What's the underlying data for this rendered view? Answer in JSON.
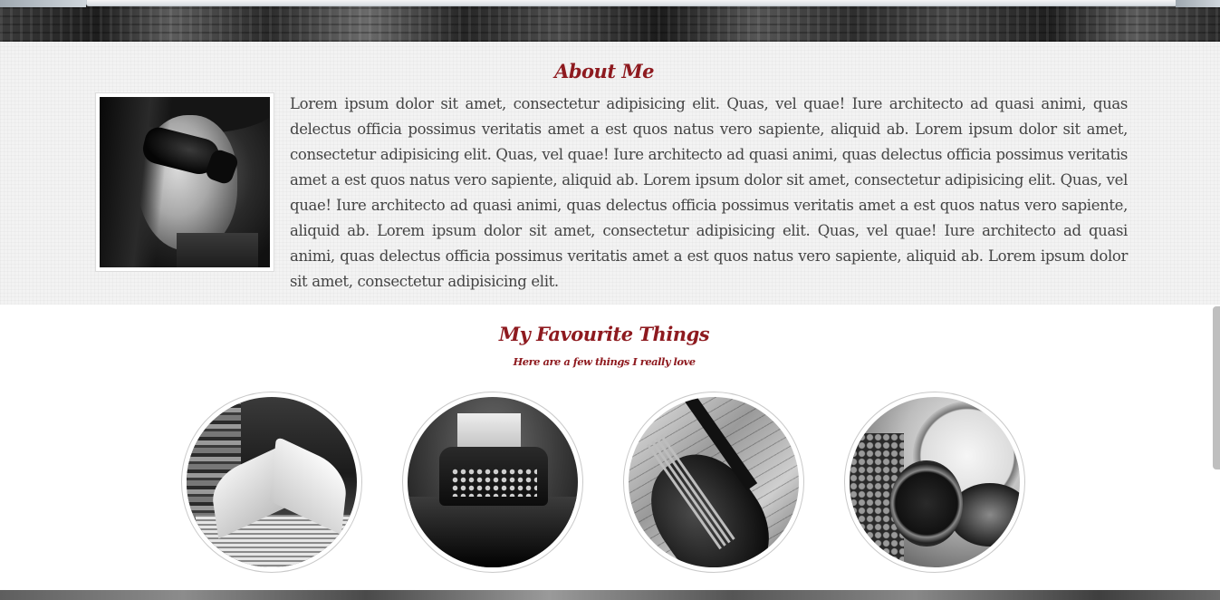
{
  "about": {
    "title": "About Me",
    "body": "Lorem ipsum dolor sit amet, consectetur adipisicing elit. Quas, vel quae! Iure architecto ad quasi animi, quas delectus officia possimus veritatis amet a est quos natus vero sapiente, aliquid ab. Lorem ipsum dolor sit amet, consectetur adipisicing elit. Quas, vel quae! Iure architecto ad quasi animi, quas delectus officia possimus veritatis amet a est quos natus vero sapiente, aliquid ab. Lorem ipsum dolor sit amet, consectetur adipisicing elit. Quas, vel quae! Iure architecto ad quasi animi, quas delectus officia possimus veritatis amet a est quos natus vero sapiente, aliquid ab. Lorem ipsum dolor sit amet, consectetur adipisicing elit. Quas, vel quae! Iure architecto ad quasi animi, quas delectus officia possimus veritatis amet a est quos natus vero sapiente, aliquid ab. Lorem ipsum dolor sit amet, consectetur adipisicing elit."
  },
  "favourites": {
    "title": "My Favourite Things",
    "subtitle": "Here are a few things I really love",
    "items": [
      {
        "icon": "books-photo"
      },
      {
        "icon": "typewriter-photo"
      },
      {
        "icon": "violin-photo"
      },
      {
        "icon": "pocket-watch-photo"
      }
    ]
  },
  "colors": {
    "heading": "#8e1a1f",
    "body_text": "#444444",
    "about_background": "#f3f3f3",
    "favourites_background": "#ffffff"
  }
}
